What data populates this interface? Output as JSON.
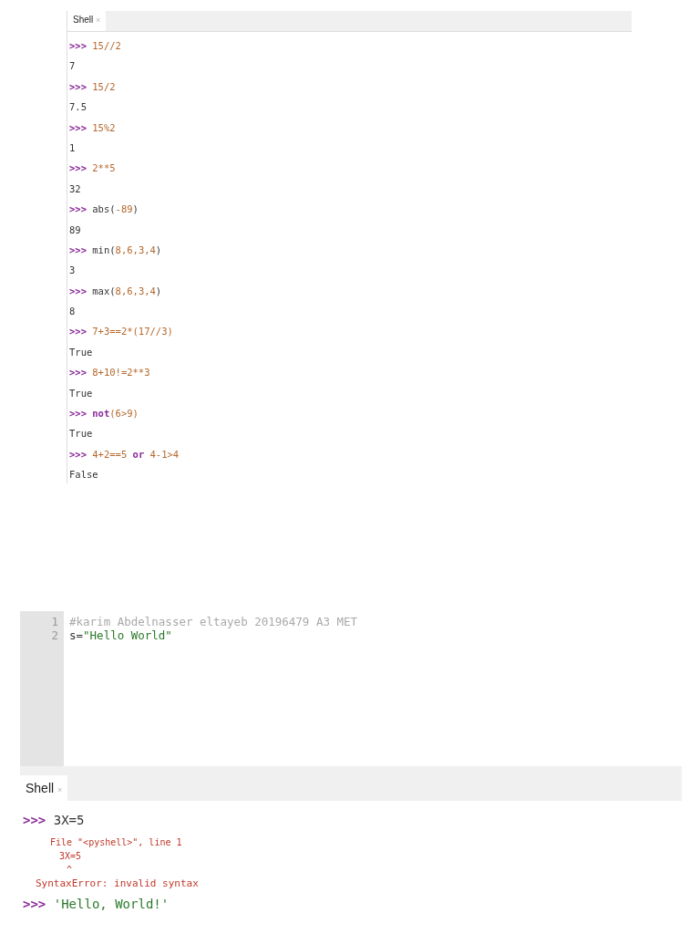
{
  "shell_top": {
    "tab": {
      "label": "Shell",
      "close": "×"
    },
    "entries": [
      {
        "kind": "input",
        "prompt": ">>>",
        "tokens": [
          {
            "kind": "number",
            "text": "15//2"
          }
        ]
      },
      {
        "kind": "output",
        "text": "7"
      },
      {
        "kind": "input",
        "prompt": ">>>",
        "tokens": [
          {
            "kind": "number",
            "text": "15/2"
          }
        ]
      },
      {
        "kind": "output",
        "text": "7.5"
      },
      {
        "kind": "input",
        "prompt": ">>>",
        "tokens": [
          {
            "kind": "number",
            "text": "15%2"
          }
        ]
      },
      {
        "kind": "output",
        "text": "1"
      },
      {
        "kind": "input",
        "prompt": ">>>",
        "tokens": [
          {
            "kind": "number",
            "text": "2**5"
          }
        ]
      },
      {
        "kind": "output",
        "text": "32"
      },
      {
        "kind": "input",
        "prompt": ">>>",
        "tokens": [
          {
            "kind": "plain",
            "text": "abs("
          },
          {
            "kind": "number",
            "text": "-89"
          },
          {
            "kind": "plain",
            "text": ")"
          }
        ]
      },
      {
        "kind": "output",
        "text": "89"
      },
      {
        "kind": "input",
        "prompt": ">>>",
        "tokens": [
          {
            "kind": "plain",
            "text": "min("
          },
          {
            "kind": "number",
            "text": "8,6,3,4"
          },
          {
            "kind": "plain",
            "text": ")"
          }
        ]
      },
      {
        "kind": "output",
        "text": "3"
      },
      {
        "kind": "input",
        "prompt": ">>>",
        "tokens": [
          {
            "kind": "plain",
            "text": "max("
          },
          {
            "kind": "number",
            "text": "8,6,3,4"
          },
          {
            "kind": "plain",
            "text": ")"
          }
        ]
      },
      {
        "kind": "output",
        "text": "8"
      },
      {
        "kind": "input",
        "prompt": ">>>",
        "tokens": [
          {
            "kind": "number",
            "text": "7+3==2*(17//3)"
          }
        ]
      },
      {
        "kind": "output",
        "text": "True"
      },
      {
        "kind": "input",
        "prompt": ">>>",
        "tokens": [
          {
            "kind": "number",
            "text": "8+10!=2**3"
          }
        ]
      },
      {
        "kind": "output",
        "text": "True"
      },
      {
        "kind": "input",
        "prompt": ">>>",
        "tokens": [
          {
            "kind": "keyword",
            "text": "not"
          },
          {
            "kind": "number",
            "text": "(6>9)"
          }
        ]
      },
      {
        "kind": "output",
        "text": "True"
      },
      {
        "kind": "input",
        "prompt": ">>>",
        "tokens": [
          {
            "kind": "number",
            "text": "4+2==5 "
          },
          {
            "kind": "keyword",
            "text": "or"
          },
          {
            "kind": "number",
            "text": " 4-1>4"
          }
        ]
      },
      {
        "kind": "output",
        "text": "False"
      }
    ]
  },
  "editor": {
    "lines": [
      {
        "number": "1",
        "tokens": [
          {
            "kind": "comment",
            "text": "#karim Abdelnasser eltayeb 20196479 A3 MET"
          }
        ]
      },
      {
        "number": "2",
        "tokens": [
          {
            "kind": "plain",
            "text": "s="
          },
          {
            "kind": "string",
            "text": "\"Hello World\""
          }
        ]
      }
    ]
  },
  "shell_bottom": {
    "tab": {
      "label": "Shell",
      "close": "×"
    },
    "entries": [
      {
        "kind": "input",
        "prompt": ">>>",
        "tokens": [
          {
            "kind": "plain",
            "text": "3X=5"
          }
        ]
      },
      {
        "kind": "error-location",
        "text": "File \"<pyshell>\", line 1"
      },
      {
        "kind": "error-source",
        "text": "3X=5"
      },
      {
        "kind": "error-caret",
        "text": "^"
      },
      {
        "kind": "error-message",
        "text": "SyntaxError: invalid syntax"
      },
      {
        "kind": "input",
        "prompt": ">>>",
        "tokens": [
          {
            "kind": "string",
            "text": "'Hello, World!'"
          }
        ]
      }
    ]
  }
}
